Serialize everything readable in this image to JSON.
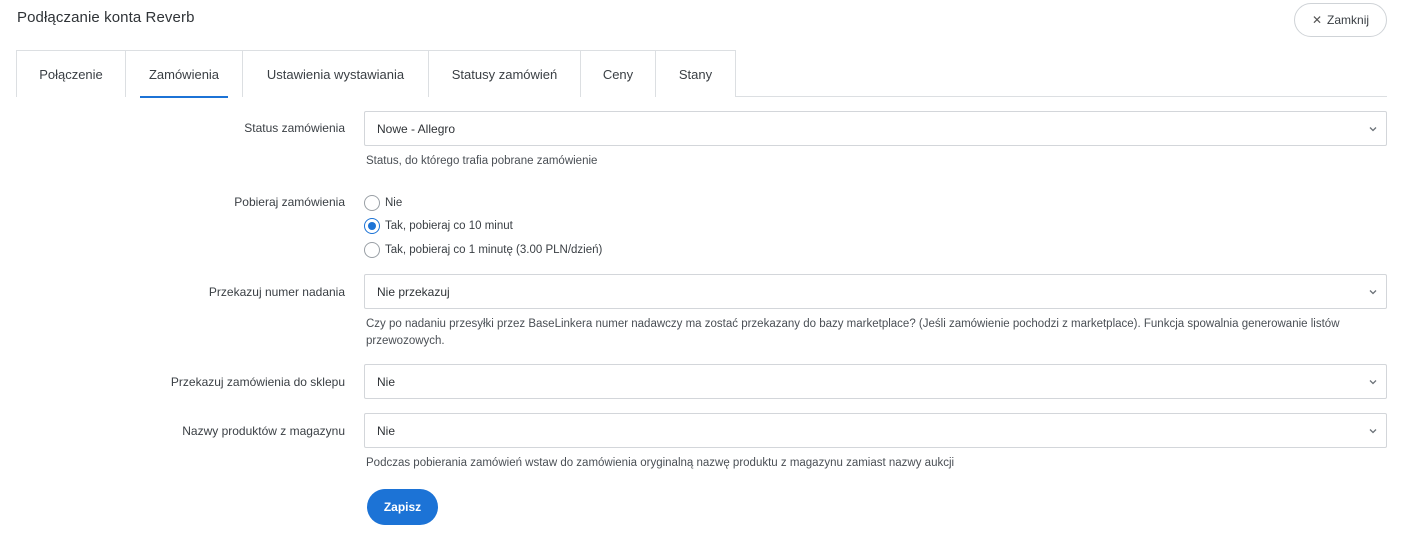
{
  "header": {
    "title": "Podłączanie konta Reverb",
    "close_label": "Zamknij"
  },
  "tabs": [
    {
      "label": "Połączenie",
      "active": false
    },
    {
      "label": "Zamówienia",
      "active": true
    },
    {
      "label": "Ustawienia wystawiania",
      "active": false
    },
    {
      "label": "Statusy zamówień",
      "active": false
    },
    {
      "label": "Ceny",
      "active": false
    },
    {
      "label": "Stany",
      "active": false
    }
  ],
  "form": {
    "order_status": {
      "label": "Status zamówienia",
      "value": "Nowe - Allegro",
      "help": "Status, do którego trafia pobrane zamówienie"
    },
    "fetch_orders": {
      "label": "Pobieraj zamówienia",
      "options": [
        {
          "label": "Nie",
          "checked": false
        },
        {
          "label": "Tak, pobieraj co 10 minut",
          "checked": true
        },
        {
          "label": "Tak, pobieraj co 1 minutę (3.00 PLN/dzień)",
          "checked": false
        }
      ]
    },
    "tracking_number": {
      "label": "Przekazuj numer nadania",
      "value": "Nie przekazuj",
      "help": "Czy po nadaniu przesyłki przez BaseLinkera numer nadawczy ma zostać przekazany do bazy marketplace? (Jeśli zamówienie pochodzi z marketplace). Funkcja spowalnia generowanie listów przewozowych."
    },
    "pass_to_shop": {
      "label": "Przekazuj zamówienia do sklepu",
      "value": "Nie"
    },
    "warehouse_names": {
      "label": "Nazwy produktów z magazynu",
      "value": "Nie",
      "help": "Podczas pobierania zamówień wstaw do zamówienia oryginalną nazwę produktu z magazynu zamiast nazwy aukcji"
    }
  },
  "save_label": "Zapisz",
  "colors": {
    "accent": "#1c73d6",
    "border": "#d3d6da"
  }
}
